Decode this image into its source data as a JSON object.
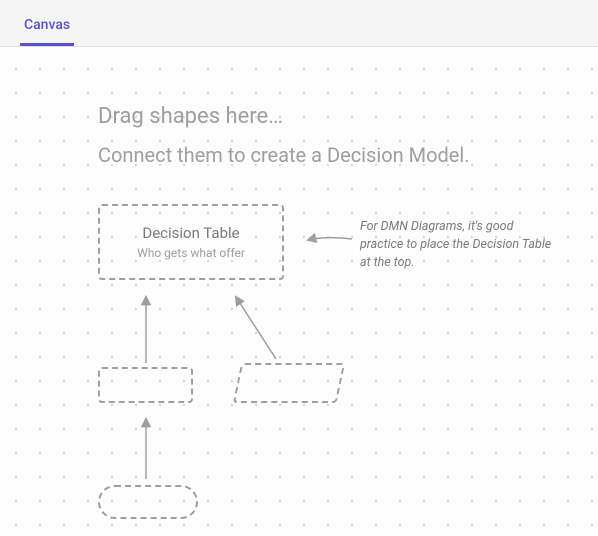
{
  "tab": {
    "label": "Canvas"
  },
  "placeholder": {
    "line1": "Drag shapes here…",
    "line2": "Connect them to create a Decision Model."
  },
  "decision_table": {
    "title": "Decision Table",
    "subtitle": "Who gets what offer"
  },
  "tip": "For DMN Diagrams, it's good practice to place the Decision Table at the top."
}
